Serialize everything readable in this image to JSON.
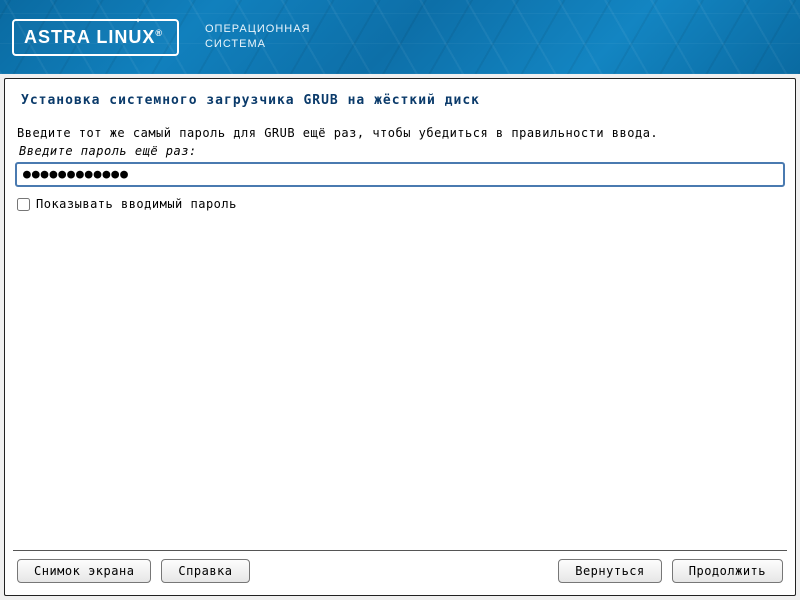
{
  "banner": {
    "logo_text": "ASTRA LINUX",
    "registered": "®",
    "subtitle_line1": "ОПЕРАЦИОННАЯ",
    "subtitle_line2": "СИСТЕМА"
  },
  "page": {
    "title": "Установка системного загрузчика GRUB на жёсткий диск",
    "instruction": "Введите тот же самый пароль для GRUB ещё раз, чтобы убедиться в правильности ввода.",
    "field_label": "Введите пароль ещё раз:",
    "password_mask": "●●●●●●●●●●●●",
    "show_password_label": "Показывать вводимый пароль",
    "show_password_checked": false
  },
  "buttons": {
    "screenshot": "Снимок экрана",
    "help": "Справка",
    "back": "Вернуться",
    "continue": "Продолжить"
  }
}
